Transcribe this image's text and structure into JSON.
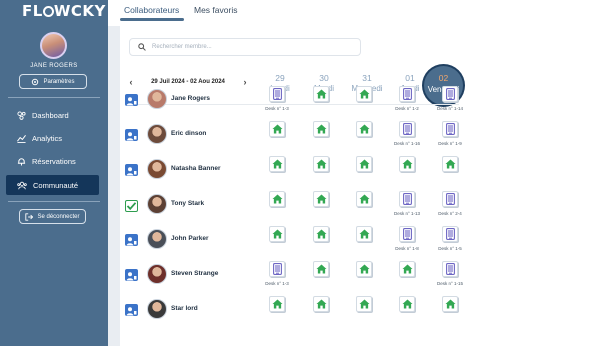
{
  "app": {
    "logo": "FL",
    "logo_after": "WCKY"
  },
  "sidebar": {
    "username": "JANE ROGERS",
    "params_label": "Paramètres",
    "nav": [
      {
        "label": "Dashboard",
        "icon": "dashboard-icon",
        "active": false
      },
      {
        "label": "Analytics",
        "icon": "analytics-icon",
        "active": false
      },
      {
        "label": "Réservations",
        "icon": "reservations-icon",
        "active": false
      },
      {
        "label": "Communauté",
        "icon": "community-icon",
        "active": true
      }
    ],
    "logout_label": "Se déconnecter"
  },
  "tabs": [
    {
      "label": "Collaborateurs",
      "active": true
    },
    {
      "label": "Mes favoris",
      "active": false
    }
  ],
  "search": {
    "placeholder": "Rechercher membre..."
  },
  "week": {
    "label": "29 Juil 2024  -  02 Aou 2024",
    "prev": "‹",
    "next": "›"
  },
  "days": [
    {
      "num": "29",
      "name": "Lundi"
    },
    {
      "num": "30",
      "name": "Mardi"
    },
    {
      "num": "31",
      "name": "Mercredi"
    },
    {
      "num": "01",
      "name": "Jeudi"
    },
    {
      "num": "02",
      "name": "Vendredi",
      "today": true
    }
  ],
  "colors": {
    "home": "#33a853",
    "desk": "#6d66c4",
    "status_blue": "#3b73c8",
    "status_green": "#2e9d4f"
  },
  "rows": [
    {
      "name": "Jane Rogers",
      "status": "blue",
      "avatar": "#b87a6a",
      "cells": [
        {
          "type": "desk",
          "label": "Desk n° 1-3"
        },
        {
          "type": "home"
        },
        {
          "type": "home"
        },
        {
          "type": "desk",
          "label": "Desk n° 1-2"
        },
        {
          "type": "desk",
          "label": "Desk n° 1-14"
        }
      ]
    },
    {
      "name": "Eric dinson",
      "status": "blue",
      "avatar": "#6d4b3b",
      "cells": [
        {
          "type": "home"
        },
        {
          "type": "home"
        },
        {
          "type": "home"
        },
        {
          "type": "desk",
          "label": "Desk n° 1-16"
        },
        {
          "type": "desk",
          "label": "Desk n° 1-9"
        }
      ]
    },
    {
      "name": "Natasha Banner",
      "status": "blue",
      "avatar": "#7a4a33",
      "cells": [
        {
          "type": "home"
        },
        {
          "type": "home"
        },
        {
          "type": "home"
        },
        {
          "type": "home"
        },
        {
          "type": "home"
        }
      ]
    },
    {
      "name": "Tony Stark",
      "status": "green",
      "avatar": "#5c4034",
      "cells": [
        {
          "type": "home"
        },
        {
          "type": "home"
        },
        {
          "type": "home"
        },
        {
          "type": "desk",
          "label": "Desk n° 1-13"
        },
        {
          "type": "desk",
          "label": "Desk n° 2-4"
        }
      ]
    },
    {
      "name": "John Parker",
      "status": "blue",
      "avatar": "#4a4f58",
      "cells": [
        {
          "type": "home"
        },
        {
          "type": "home"
        },
        {
          "type": "home"
        },
        {
          "type": "desk",
          "label": "Desk n° 1-8"
        },
        {
          "type": "desk",
          "label": "Desk n° 1-5"
        }
      ]
    },
    {
      "name": "Steven Strange",
      "status": "blue",
      "avatar": "#6e2f2a",
      "cells": [
        {
          "type": "desk",
          "label": "Desk n° 1-3"
        },
        {
          "type": "home"
        },
        {
          "type": "home"
        },
        {
          "type": "home"
        },
        {
          "type": "desk",
          "label": "Desk n° 1-15"
        }
      ]
    },
    {
      "name": "Star lord",
      "status": "blue",
      "avatar": "#3a3a3a",
      "cells": [
        {
          "type": "home"
        },
        {
          "type": "home"
        },
        {
          "type": "home"
        },
        {
          "type": "home"
        },
        {
          "type": "home"
        }
      ]
    }
  ]
}
